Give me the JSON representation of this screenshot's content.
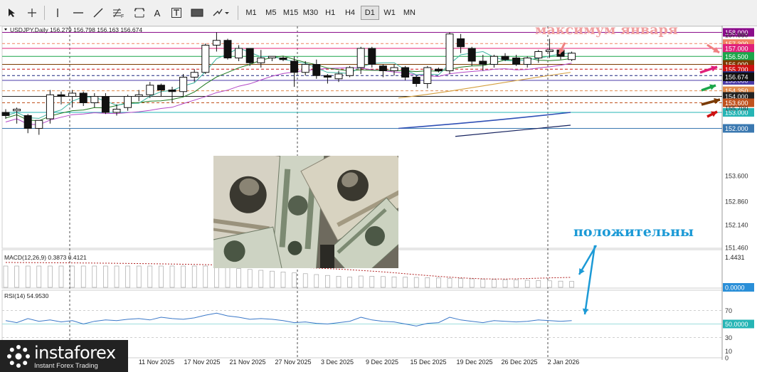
{
  "toolbar": {
    "icons": [
      "cursor-icon",
      "crosshair-icon",
      "vertical-line-icon",
      "horizontal-line-icon",
      "trend-line-icon",
      "fibonacci-icon",
      "text-icon",
      "text-label-icon",
      "rectangle-icon",
      "shapes-menu-icon"
    ],
    "text_tool": "A",
    "timeframes": [
      "M1",
      "M5",
      "M15",
      "M30",
      "H1",
      "H4",
      "D1",
      "W1",
      "MN"
    ],
    "active_timeframe": "D1"
  },
  "chart_data": {
    "type": "candlestick",
    "symbol_header": "USDJPY,Daily",
    "ohlc_header": "156.279 156.798 156.163 156.674",
    "last_price": "156.674",
    "price_axis": [
      "157.880",
      "156.674",
      "155.700",
      "153.600",
      "152.860",
      "152.140",
      "151.460"
    ],
    "date_labels": [
      "11 Nov 2025",
      "17 Nov 2025",
      "21 Nov 2025",
      "27 Nov 2025",
      "3 Dec 2025",
      "9 Dec 2025",
      "15 Dec 2025",
      "19 Dec 2025",
      "26 Dec 2025",
      "2 Jan 2026"
    ],
    "levels": [
      {
        "label": "158.000",
        "price": 158.0,
        "color": "#8b0d8b",
        "style": "solid"
      },
      {
        "label": "157.300",
        "price": 157.3,
        "color": "#f08060",
        "style": "dashed"
      },
      {
        "label": "157.000",
        "price": 157.0,
        "color": "#e0207a",
        "style": "solid"
      },
      {
        "label": "156.500",
        "price": 156.5,
        "color": "#1aa64a",
        "style": "solid"
      },
      {
        "label": "156.000",
        "price": 156.0,
        "color": "#7a3a00",
        "style": "solid"
      },
      {
        "label": "155.700",
        "price": 155.7,
        "color": "#cc1111",
        "style": "dashed"
      },
      {
        "label": "155.300",
        "price": 155.3,
        "color": "#1a237e",
        "style": "dashed"
      },
      {
        "label": "155.000",
        "price": 155.0,
        "color": "#4b3ba8",
        "style": "solid"
      },
      {
        "label": "154.350",
        "price": 154.35,
        "color": "#e08a4c",
        "style": "dashed"
      },
      {
        "label": "154.000",
        "price": 154.0,
        "color": "#222222",
        "style": "solid"
      },
      {
        "label": "153.600",
        "price": 153.6,
        "color": "#c0521e",
        "style": "dashed"
      },
      {
        "label": "153.000",
        "price": 153.0,
        "color": "#26b5b5",
        "style": "solid"
      },
      {
        "label": "152.000",
        "price": 152.0,
        "color": "#3a78b0",
        "style": "solid"
      }
    ],
    "candles": [
      {
        "o": 153.0,
        "h": 153.2,
        "l": 152.6,
        "c": 152.8
      },
      {
        "o": 153.1,
        "h": 153.3,
        "l": 152.3,
        "c": 153.2
      },
      {
        "o": 152.8,
        "h": 152.9,
        "l": 151.7,
        "c": 152.0
      },
      {
        "o": 152.0,
        "h": 152.4,
        "l": 151.6,
        "c": 152.5
      },
      {
        "o": 152.6,
        "h": 154.4,
        "l": 152.3,
        "c": 154.1
      },
      {
        "o": 154.1,
        "h": 154.3,
        "l": 153.5,
        "c": 154.0
      },
      {
        "o": 154.0,
        "h": 154.4,
        "l": 153.3,
        "c": 154.2
      },
      {
        "o": 154.2,
        "h": 154.3,
        "l": 153.4,
        "c": 153.6
      },
      {
        "o": 153.6,
        "h": 154.2,
        "l": 153.3,
        "c": 154.0
      },
      {
        "o": 154.0,
        "h": 154.2,
        "l": 152.9,
        "c": 153.0
      },
      {
        "o": 153.0,
        "h": 153.5,
        "l": 152.8,
        "c": 153.2
      },
      {
        "o": 153.3,
        "h": 154.1,
        "l": 153.1,
        "c": 154.0
      },
      {
        "o": 154.0,
        "h": 154.4,
        "l": 153.7,
        "c": 154.1
      },
      {
        "o": 154.1,
        "h": 154.9,
        "l": 153.9,
        "c": 154.7
      },
      {
        "o": 154.7,
        "h": 154.8,
        "l": 154.0,
        "c": 154.4
      },
      {
        "o": 154.4,
        "h": 154.6,
        "l": 153.6,
        "c": 154.3
      },
      {
        "o": 154.3,
        "h": 155.4,
        "l": 154.0,
        "c": 155.2
      },
      {
        "o": 155.2,
        "h": 155.7,
        "l": 154.9,
        "c": 155.5
      },
      {
        "o": 155.5,
        "h": 157.3,
        "l": 155.4,
        "c": 157.2
      },
      {
        "o": 157.2,
        "h": 158.0,
        "l": 156.8,
        "c": 157.5
      },
      {
        "o": 157.5,
        "h": 157.6,
        "l": 156.3,
        "c": 156.4
      },
      {
        "o": 156.4,
        "h": 157.2,
        "l": 156.2,
        "c": 157.0
      },
      {
        "o": 157.0,
        "h": 157.0,
        "l": 155.9,
        "c": 156.1
      },
      {
        "o": 156.1,
        "h": 156.9,
        "l": 155.8,
        "c": 156.4
      },
      {
        "o": 156.4,
        "h": 156.5,
        "l": 156.2,
        "c": 156.5
      },
      {
        "o": 156.4,
        "h": 156.5,
        "l": 156.2,
        "c": 156.3
      },
      {
        "o": 156.2,
        "h": 156.5,
        "l": 154.6,
        "c": 155.5
      },
      {
        "o": 155.5,
        "h": 156.2,
        "l": 155.3,
        "c": 156.0
      },
      {
        "o": 156.0,
        "h": 156.3,
        "l": 155.1,
        "c": 155.3
      },
      {
        "o": 155.3,
        "h": 155.4,
        "l": 154.8,
        "c": 155.2
      },
      {
        "o": 155.1,
        "h": 155.6,
        "l": 154.9,
        "c": 155.4
      },
      {
        "o": 155.3,
        "h": 155.9,
        "l": 155.2,
        "c": 155.8
      },
      {
        "o": 155.8,
        "h": 157.1,
        "l": 155.4,
        "c": 157.0
      },
      {
        "o": 157.0,
        "h": 157.1,
        "l": 155.8,
        "c": 156.0
      },
      {
        "o": 155.9,
        "h": 156.0,
        "l": 155.2,
        "c": 155.6
      },
      {
        "o": 155.6,
        "h": 156.0,
        "l": 155.3,
        "c": 155.8
      },
      {
        "o": 155.8,
        "h": 155.9,
        "l": 155.0,
        "c": 155.2
      },
      {
        "o": 155.2,
        "h": 155.3,
        "l": 154.6,
        "c": 154.8
      },
      {
        "o": 154.8,
        "h": 155.9,
        "l": 154.5,
        "c": 155.8
      },
      {
        "o": 155.7,
        "h": 155.8,
        "l": 155.5,
        "c": 155.6
      },
      {
        "o": 155.6,
        "h": 158.0,
        "l": 155.4,
        "c": 157.9
      },
      {
        "o": 157.6,
        "h": 157.9,
        "l": 156.7,
        "c": 157.1
      },
      {
        "o": 157.0,
        "h": 157.1,
        "l": 155.9,
        "c": 156.2
      },
      {
        "o": 156.2,
        "h": 156.6,
        "l": 155.6,
        "c": 156.0
      },
      {
        "o": 156.0,
        "h": 156.6,
        "l": 155.8,
        "c": 156.5
      },
      {
        "o": 156.5,
        "h": 156.7,
        "l": 156.2,
        "c": 156.3
      },
      {
        "o": 156.4,
        "h": 156.6,
        "l": 155.9,
        "c": 156.0
      },
      {
        "o": 156.0,
        "h": 156.5,
        "l": 155.8,
        "c": 156.4
      },
      {
        "o": 156.4,
        "h": 156.9,
        "l": 156.1,
        "c": 156.8
      },
      {
        "o": 156.8,
        "h": 157.6,
        "l": 156.4,
        "c": 156.9
      },
      {
        "o": 156.9,
        "h": 157.0,
        "l": 156.3,
        "c": 156.5
      },
      {
        "o": 156.3,
        "h": 156.8,
        "l": 156.2,
        "c": 156.7
      }
    ],
    "macd": {
      "label": "MACD(12,26,9) 0.3873 0.4121",
      "scale_top": "1.4431",
      "zero_label": "0.0000"
    },
    "rsi": {
      "label": "RSI(14) 54.9530",
      "ticks": [
        "70",
        "50",
        "30",
        "10",
        "0"
      ],
      "current_label": "50.0000"
    }
  },
  "annotations": {
    "january_max": "максимум января",
    "positive": "положительны"
  },
  "watermark": {
    "brand": "instaforex",
    "tagline": "Instant Forex Trading"
  }
}
